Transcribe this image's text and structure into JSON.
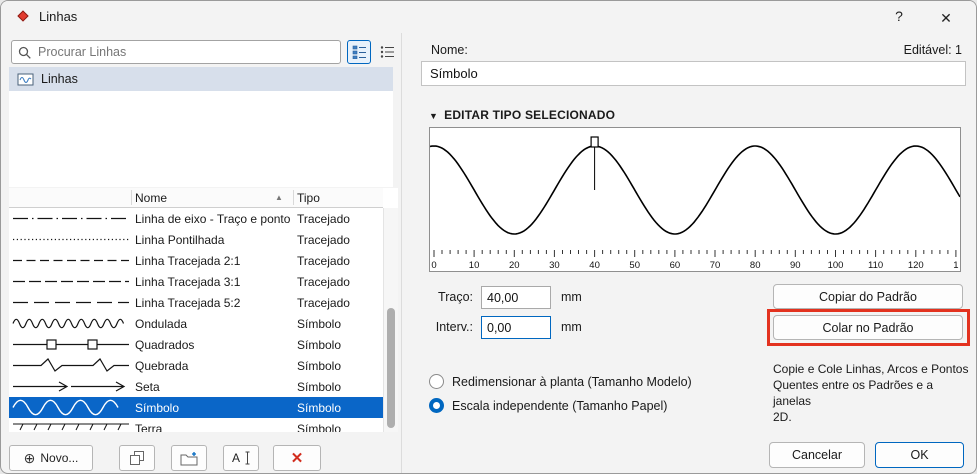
{
  "window": {
    "title": "Linhas",
    "help_label": "?",
    "close_label": "✕"
  },
  "left": {
    "search": {
      "placeholder": "Procurar Linhas"
    },
    "folder": {
      "label": "Linhas"
    },
    "table": {
      "columns": {
        "nome": "Nome",
        "tipo": "Tipo"
      },
      "sort_indicator": "▲",
      "rows": [
        {
          "nome": "Linha de eixo - Traço e ponto",
          "tipo": "Tracejado",
          "preview": "dash-dot",
          "selected": false
        },
        {
          "nome": "Linha Pontilhada",
          "tipo": "Tracejado",
          "preview": "dotted",
          "selected": false
        },
        {
          "nome": "Linha Tracejada 2:1",
          "tipo": "Tracejado",
          "preview": "dashed-2-1",
          "selected": false
        },
        {
          "nome": "Linha Tracejada 3:1",
          "tipo": "Tracejado",
          "preview": "dashed-3-1",
          "selected": false
        },
        {
          "nome": "Linha Tracejada 5:2",
          "tipo": "Tracejado",
          "preview": "dashed-5-2",
          "selected": false
        },
        {
          "nome": "Ondulada",
          "tipo": "Símbolo",
          "preview": "wave-small",
          "selected": false
        },
        {
          "nome": "Quadrados",
          "tipo": "Símbolo",
          "preview": "squares",
          "selected": false
        },
        {
          "nome": "Quebrada",
          "tipo": "Símbolo",
          "preview": "zigzag",
          "selected": false
        },
        {
          "nome": "Seta",
          "tipo": "Símbolo",
          "preview": "arrow",
          "selected": false
        },
        {
          "nome": "Símbolo",
          "tipo": "Símbolo",
          "preview": "wave-large",
          "selected": true
        },
        {
          "nome": "Terra",
          "tipo": "Símbolo",
          "preview": "earth",
          "selected": false
        }
      ]
    },
    "toolbar": {
      "novo": "Novo...",
      "novo_icon": "⊕",
      "rename_icon": "A",
      "delete_icon": "✕"
    }
  },
  "right": {
    "name_label": "Nome:",
    "editable_label": "Editável: 1",
    "name_value": "Símbolo",
    "section_arrow": "▼",
    "section_title": "EDITAR TIPO SELECIONADO",
    "ruler": {
      "labels": [
        "0",
        "10",
        "20",
        "30",
        "40",
        "50",
        "60",
        "70",
        "80",
        "90",
        "100",
        "110",
        "120",
        "1"
      ]
    },
    "fields": {
      "traco_label": "Traço:",
      "traco_value": "40,00",
      "traco_unit": "mm",
      "interv_label": "Interv.:",
      "interv_value": "0,00",
      "interv_unit": "mm"
    },
    "buttons": {
      "copiar": "Copiar do Padrão",
      "colar": "Colar no Padrão",
      "cancelar": "Cancelar",
      "ok": "OK"
    },
    "radios": {
      "option1": "Redimensionar à planta (Tamanho Modelo)",
      "option2": "Escala independente (Tamanho Papel)",
      "selected": "option2"
    },
    "hint": "Copie e Cole Linhas, Arcos e Pontos\nQuentes entre os Padrões e a janelas\n2D."
  },
  "colors": {
    "selection": "#0a66c8",
    "focus": "#0067c0",
    "annotation": "#e3321f"
  }
}
